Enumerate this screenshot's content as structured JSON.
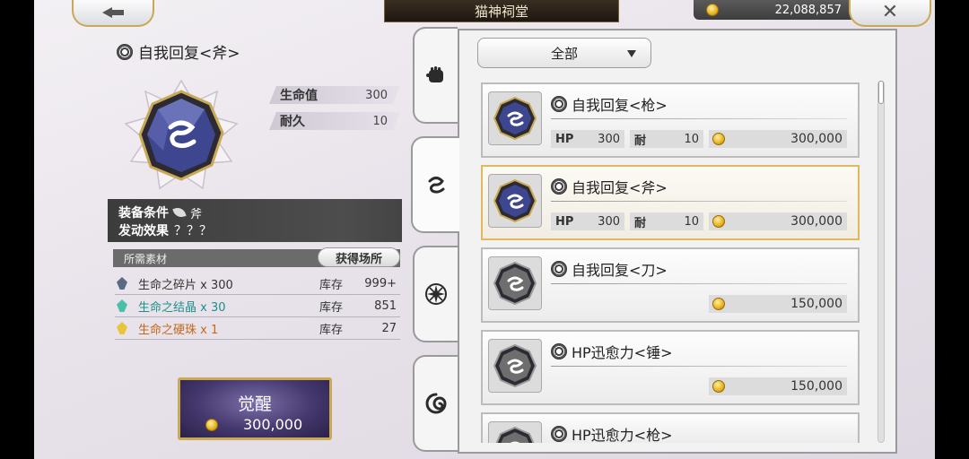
{
  "header": {
    "title": "猫神祠堂",
    "currency_amount": "22,088,857"
  },
  "selected_skill": {
    "name": "自我回复<斧>",
    "stats": [
      {
        "label": "生命值",
        "value": "300"
      },
      {
        "label": "耐久",
        "value": "10"
      }
    ],
    "equip_condition_label": "装备条件",
    "equip_condition_value": "斧",
    "effect_label": "发动效果",
    "effect_value": "？？？"
  },
  "materials": {
    "header_label": "所需素材",
    "get_location_label": "获得场所",
    "stock_label": "库存",
    "items": [
      {
        "name": "生命之碎片 x 300",
        "stock": "999+",
        "color": "#333333",
        "icon_color": "#5a6a85"
      },
      {
        "name": "生命之结晶 x 30",
        "stock": "851",
        "color": "#1f8f8a",
        "icon_color": "#49c0a8"
      },
      {
        "name": "生命之硬珠 x 1",
        "stock": "27",
        "color": "#c4671a",
        "icon_color": "#e7c43a"
      }
    ]
  },
  "awaken": {
    "label": "觉醒",
    "cost": "300,000"
  },
  "tabs": [
    {
      "icon": "fist-icon"
    },
    {
      "icon": "swirl-icon"
    },
    {
      "icon": "star-burst-icon"
    },
    {
      "icon": "vortex-icon"
    }
  ],
  "filter": {
    "selected": "全部"
  },
  "skill_list": [
    {
      "name": "自我回复<枪>",
      "hp_label": "HP",
      "hp": "300",
      "dur_label": "耐",
      "dur": "10",
      "cost": "300,000",
      "gem": "blue",
      "selected": false
    },
    {
      "name": "自我回复<斧>",
      "hp_label": "HP",
      "hp": "300",
      "dur_label": "耐",
      "dur": "10",
      "cost": "300,000",
      "gem": "blue",
      "selected": true
    },
    {
      "name": "自我回复<刀>",
      "cost": "150,000",
      "gem": "gray",
      "selected": false
    },
    {
      "name": "HP迅愈力<锤>",
      "cost": "150,000",
      "gem": "gray",
      "selected": false
    },
    {
      "name": "HP迅愈力<枪>",
      "gem": "gray",
      "selected": false
    }
  ],
  "colors": {
    "accent_gold": "#c9a955",
    "gem_blue": "#3e4690",
    "gem_gray": "#6e6e6e"
  }
}
